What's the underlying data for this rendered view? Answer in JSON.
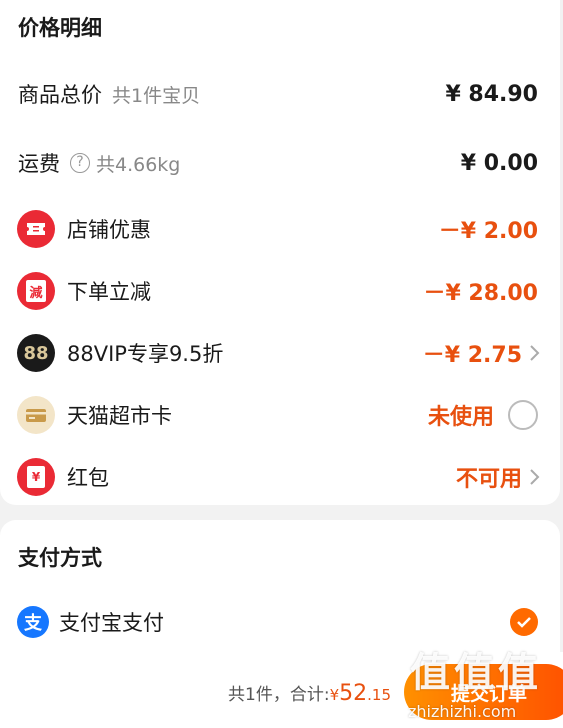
{
  "price_section": {
    "title": "价格明细",
    "goods_total": {
      "label": "商品总价",
      "sub": "共1件宝贝",
      "amount": "¥ 84.90"
    },
    "shipping": {
      "label": "运费",
      "sub": "共4.66kg",
      "amount": "¥ 0.00"
    },
    "shop_discount": {
      "label": "店铺优惠",
      "amount": "－¥ 2.00",
      "icon": "ticket-icon"
    },
    "order_reduce": {
      "label": "下单立减",
      "amount": "－¥ 28.00",
      "icon": "reduce-icon",
      "icon_text": "減"
    },
    "vip": {
      "label": "88VIP专享9.5折",
      "amount": "－¥ 2.75",
      "icon": "vip-88-icon",
      "icon_text": "88"
    },
    "tmall_card": {
      "label": "天猫超市卡",
      "amount": "未使用",
      "icon": "card-icon"
    },
    "red_packet": {
      "label": "红包",
      "amount": "不可用",
      "icon": "red-packet-icon",
      "icon_text": "¥"
    }
  },
  "payment_section": {
    "title": "支付方式",
    "method": {
      "label": "支付宝支付",
      "icon": "alipay-icon",
      "icon_text": "支",
      "selected": true
    }
  },
  "bottom_bar": {
    "count": "共1件，",
    "total_label": "合计:",
    "currency": "¥",
    "total_int": "52",
    "total_dec": ".15",
    "submit_label": "提交订单"
  },
  "watermark": {
    "glyphs": "值值值",
    "url": "zhizhizhi.com"
  },
  "colors": {
    "accent": "#e8500f",
    "button": "#ff5000",
    "red_icon": "#ea2a35",
    "alipay": "#1677ff"
  }
}
